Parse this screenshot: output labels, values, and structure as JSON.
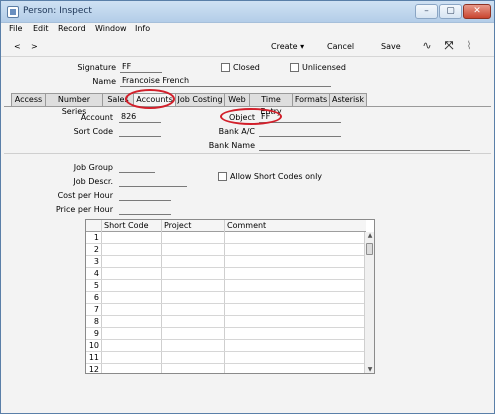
{
  "window": {
    "title": "Person: Inspect",
    "min_glyph": "–",
    "max_glyph": "▢",
    "close_glyph": "✕"
  },
  "menu": [
    "File",
    "Edit",
    "Record",
    "Window",
    "Info"
  ],
  "toolbar": {
    "prev_label": "<",
    "next_label": ">",
    "create_label": "Create",
    "cancel_label": "Cancel",
    "save_label": "Save",
    "icons": [
      "activity-icon",
      "connect-icon",
      "attachment-icon"
    ]
  },
  "header": {
    "signature_label": "Signature",
    "signature_value": "FF",
    "name_label": "Name",
    "name_value": "Francoise French",
    "closed_label": "Closed",
    "unlicensed_label": "Unlicensed"
  },
  "tabs": [
    "Access",
    "Number Series",
    "Sales",
    "Accounts",
    "Job Costing",
    "Web",
    "Time Entry",
    "Formats",
    "Asterisk"
  ],
  "active_tab": "Accounts",
  "accounts": {
    "account_label": "Account",
    "account_value": "826",
    "sort_code_label": "Sort Code",
    "sort_code_value": "",
    "object_label": "Object",
    "object_value": "FF",
    "bank_ac_label": "Bank A/C",
    "bank_ac_value": "",
    "bank_name_label": "Bank Name",
    "bank_name_value": ""
  },
  "job": {
    "job_group_label": "Job Group",
    "job_descr_label": "Job Descr.",
    "cost_per_hour_label": "Cost per Hour",
    "price_per_hour_label": "Price per Hour",
    "allow_short_codes_label": "Allow Short Codes only"
  },
  "grid": {
    "columns": [
      "Short Code",
      "Project",
      "Comment"
    ],
    "rows": [
      "1",
      "2",
      "3",
      "4",
      "5",
      "6",
      "7",
      "8",
      "9",
      "10",
      "11",
      "12"
    ]
  },
  "colors": {
    "highlight_ring": "#d21f2a"
  }
}
